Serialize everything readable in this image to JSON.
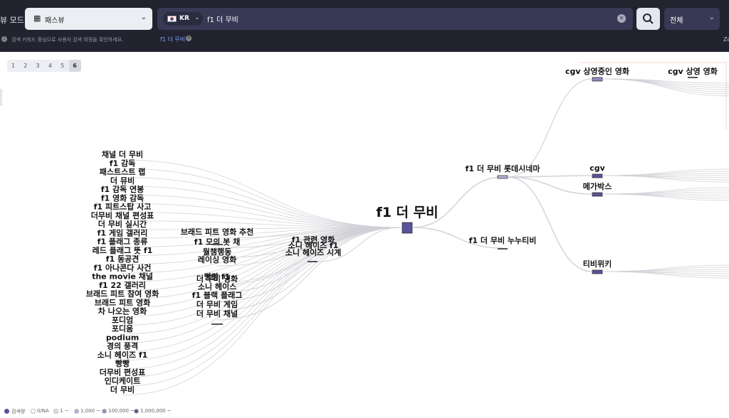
{
  "header": {
    "mode_label": "뷰 모드",
    "mode_select": {
      "value": "패스뷰",
      "icon": "map-icon"
    },
    "search": {
      "country": "KR",
      "query": "f1 더 무비"
    },
    "scope_select": {
      "value": "전체"
    },
    "zoom_hint": "Zo",
    "hint": "검색 키워드 중심으로 사용자 검색 여정을 확인하세요.",
    "chip": "f1 더 무비"
  },
  "levels": [
    "1",
    "2",
    "3",
    "4",
    "5",
    "6"
  ],
  "active_level": "6",
  "graph": {
    "center": "f1 더 무비",
    "left_column": [
      "채널 더 무비",
      "f1 감독",
      "패스트스트 랩",
      "더 뮤비",
      "f1 감독 연봉",
      "f1 영화 감독",
      "f1 피트스탑 사고",
      "더무비 채널 편성표",
      "더 무비 실시간",
      "f1 게임 갤러리",
      "f1 플래그 종류",
      "레드 플래그 뜻 f1",
      "f1 동공견",
      "f1 아나콘다 사건",
      "the movie 채널",
      "f1 22 갤러리",
      "브래드 피트 참여 영화",
      "브래드 피트 영화",
      "차 나오는 영화",
      "포디엄",
      "포디움",
      "podium",
      "경의 풍격",
      "소니 헤이즈 f1",
      "빵빵",
      "더무비 편성표",
      "인디케이트",
      "더 무비"
    ],
    "mid_column": [
      "브래드 피트 영화 추천",
      "f1 모의 봇 채",
      "월챔행동",
      "레이싱 영화",
      "빵빵 f1",
      "더 무비 영화",
      "소니 헤이스",
      "f1 블랙 플래그",
      "더 무비 게임",
      "더 무비 채널"
    ],
    "mid_right": [
      "f1 관련 영화",
      "소니 헤이즈 f1",
      "소니 헤이즈 시계"
    ],
    "right_column": [
      "f1 더 무비 롯데시네마",
      "f1 더 무비 누누티비"
    ],
    "far_right": [
      "cgv 상영중인 영화",
      "cgv 상영 영화",
      "cgv",
      "메가박스",
      "티비위키"
    ]
  },
  "legend": {
    "title": "검색량",
    "items": [
      "0/NA",
      "1 ~",
      "1,000 ~",
      "100,000 ~",
      "1,000,000 ~"
    ],
    "colors": [
      "#ffffff",
      "#dcdcec",
      "#b4b2da",
      "#8f8cc6",
      "#5a529a"
    ]
  }
}
